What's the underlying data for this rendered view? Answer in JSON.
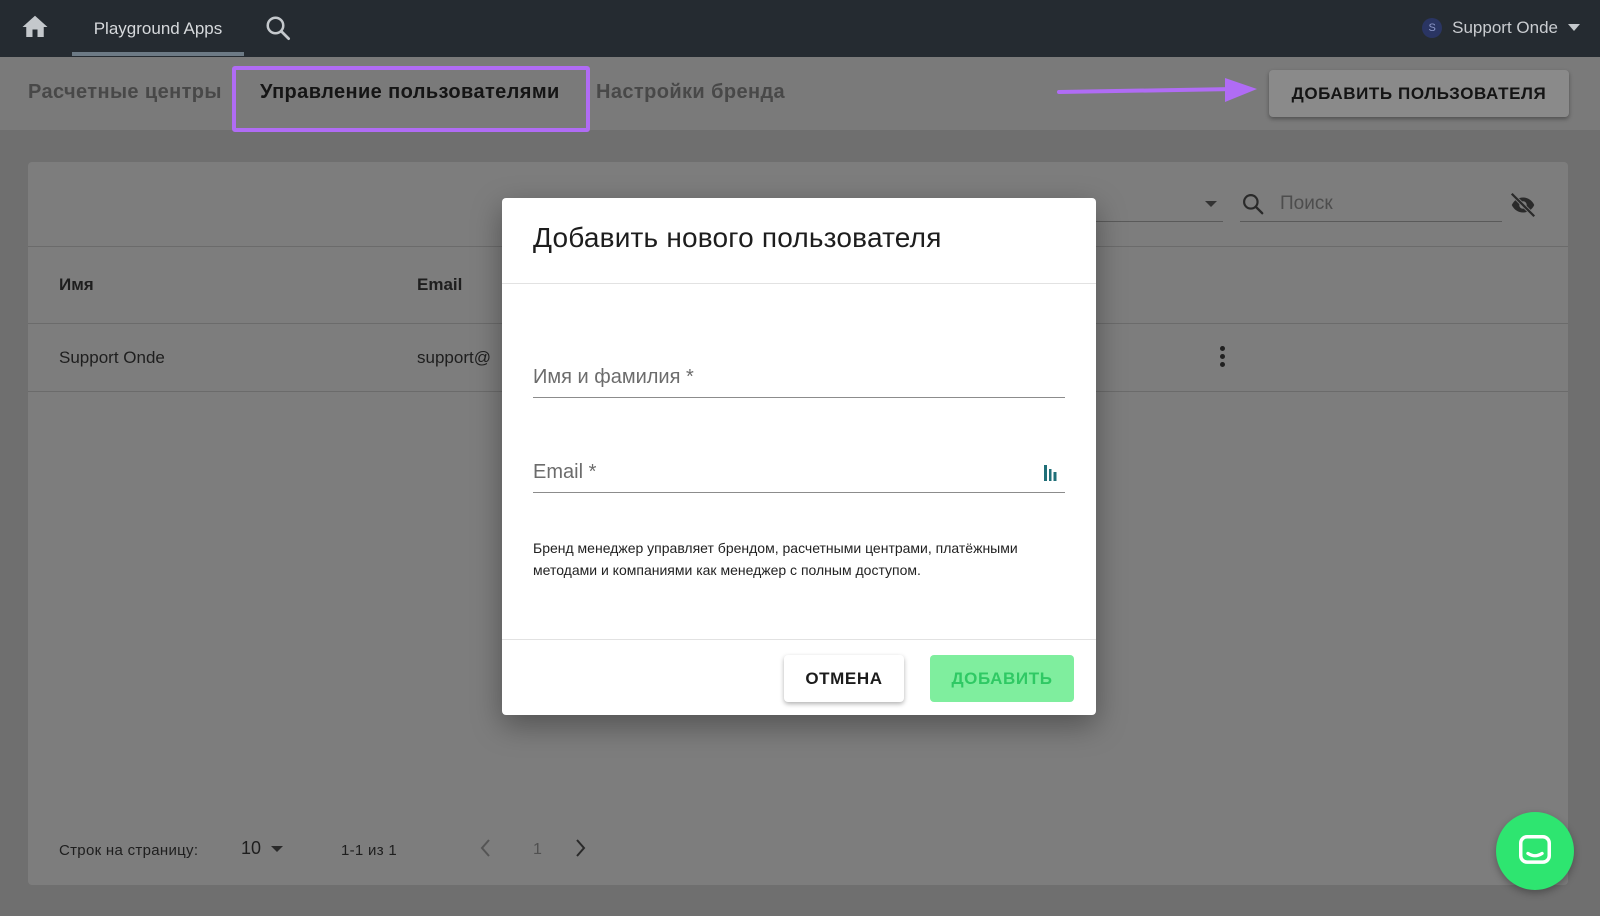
{
  "topbar": {
    "home_icon": "home-icon",
    "app_tab": "Playground Apps",
    "search_icon": "search-icon",
    "user": {
      "avatar_letter": "S",
      "name": "Support Onde"
    }
  },
  "subnav": {
    "tabs": [
      "Расчетные центры",
      "Управление пользователями",
      "Настройки бренда"
    ],
    "active_tab": "Управление пользователями",
    "add_user_label": "ДОБАВИТЬ ПОЛЬЗОВАТЕЛЯ",
    "highlight_color": "#b06cf5"
  },
  "toolbar": {
    "search_placeholder": "Поиск",
    "visibility_icon": "visibility-off-icon"
  },
  "table": {
    "columns": [
      "Имя",
      "Email"
    ],
    "rows": [
      {
        "name": "Support Onde",
        "email": "support@"
      }
    ]
  },
  "pagination": {
    "rows_per_page_label": "Строк на страницу:",
    "rows_per_page": "10",
    "range": "1-1 из 1",
    "page": "1"
  },
  "modal": {
    "title": "Добавить нового пользователя",
    "name_field_label": "Имя и фамилия *",
    "email_field_label": "Email *",
    "note": "Бренд менеджер управляет брендом, расчетными центрами, платёжными методами и компаниями как менеджер с полным доступом.",
    "cancel_label": "ОТМЕНА",
    "submit_label": "ДОБАВИТЬ",
    "submit_color": "#7fee9e"
  },
  "chat": {
    "icon": "chat-icon",
    "color": "#2ee570"
  }
}
